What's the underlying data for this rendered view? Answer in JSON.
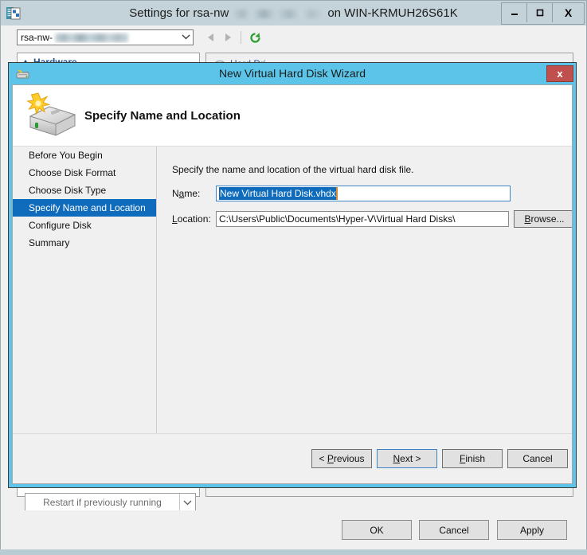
{
  "settings_window": {
    "title_prefix": "Settings for rsa-nw",
    "title_suffix": "on WIN-KRMUH26S61K",
    "title_icon": "settings-document-icon",
    "window_buttons": {
      "minimize": "–",
      "maximize": "□",
      "close": "X"
    },
    "toolbar": {
      "vm_combo_value": "rsa-nw-",
      "back_icon": "triangle-left-icon",
      "forward_icon": "triangle-right-icon",
      "refresh_icon": "refresh-icon"
    },
    "left_pane": {
      "section_header": "Hardware",
      "expander_icon": "chevron-up-icon"
    },
    "right_pane": {
      "section_header": "Hard Dri"
    },
    "restart_combo": {
      "value": "Restart if previously running",
      "arrow_icon": "chevron-down-icon"
    },
    "footer_buttons": {
      "ok": "OK",
      "cancel": "Cancel",
      "apply": "Apply"
    }
  },
  "wizard": {
    "title": "New Virtual Hard Disk Wizard",
    "title_icon": "hard-disk-icon",
    "close_label": "x",
    "header": {
      "icon": "new-hard-disk-icon",
      "title": "Specify Name and Location"
    },
    "nav_items": [
      {
        "label": "Before You Begin",
        "selected": false
      },
      {
        "label": "Choose Disk Format",
        "selected": false
      },
      {
        "label": "Choose Disk Type",
        "selected": false
      },
      {
        "label": "Specify Name and Location",
        "selected": true
      },
      {
        "label": "Configure Disk",
        "selected": false
      },
      {
        "label": "Summary",
        "selected": false
      }
    ],
    "content": {
      "intro": "Specify the name and location of the virtual hard disk file.",
      "name_label": "Name:",
      "name_value": "New Virtual Hard Disk.vhdx",
      "location_label": "Location:",
      "location_value": "C:\\Users\\Public\\Documents\\Hyper-V\\Virtual Hard Disks\\",
      "browse_label": "Browse..."
    },
    "footer_buttons": {
      "previous": "< Previous",
      "next": "Next >",
      "finish": "Finish",
      "cancel": "Cancel"
    }
  },
  "colors": {
    "wizard_frame": "#5bc4e8",
    "settings_titlebar": "#c4d3da",
    "selection_blue": "#0f6cbd",
    "close_red": "#c0504d",
    "dialog_face": "#f0f0f0"
  }
}
